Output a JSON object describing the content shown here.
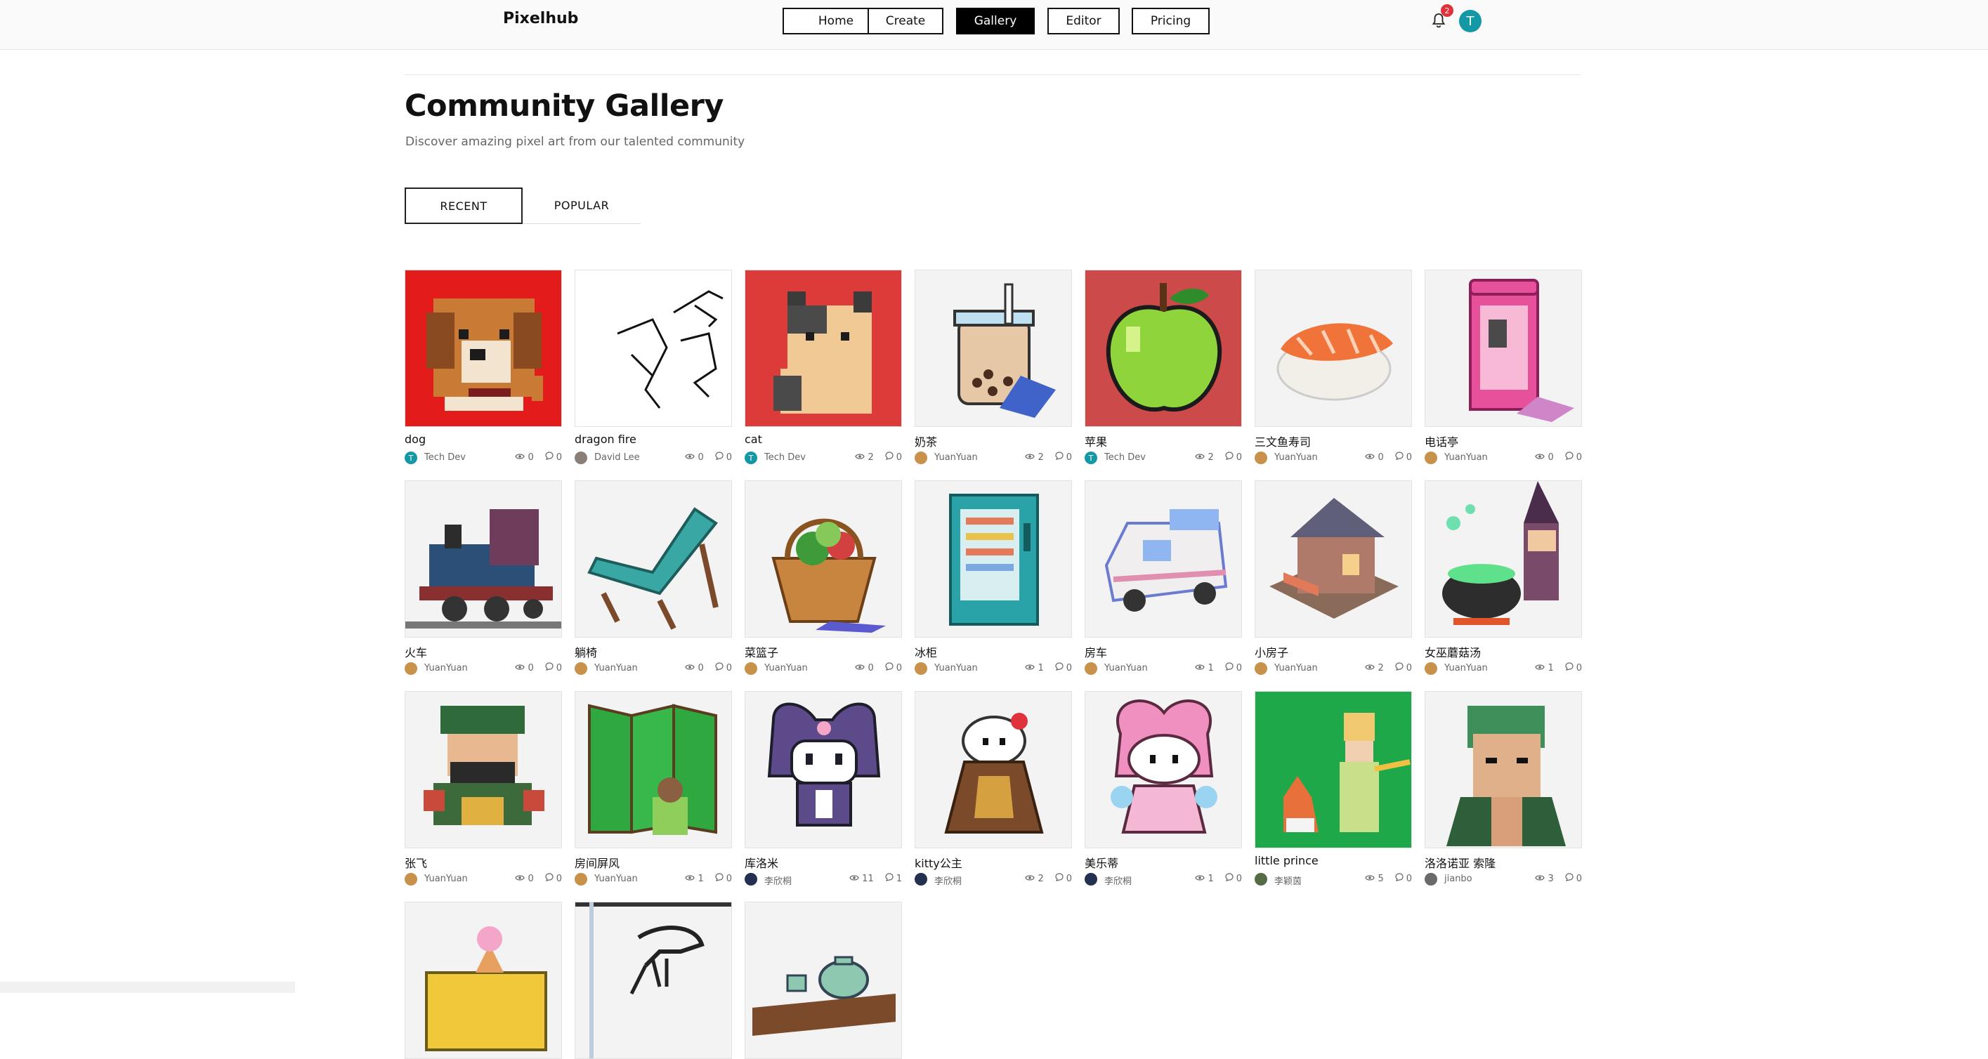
{
  "brand": "Pixelhub",
  "nav": [
    {
      "label": "Home",
      "active": false
    },
    {
      "label": "Create",
      "active": false
    },
    {
      "label": "Gallery",
      "active": true
    },
    {
      "label": "Editor",
      "active": false
    },
    {
      "label": "Pricing",
      "active": false
    }
  ],
  "notifications": {
    "count": "2"
  },
  "user": {
    "initial": "T"
  },
  "page": {
    "title": "Community Gallery",
    "subtitle": "Discover amazing pixel art from our talented community"
  },
  "tabs": [
    {
      "label": "RECENT",
      "active": true
    },
    {
      "label": "POPULAR",
      "active": false
    }
  ],
  "colors": {
    "accent": "#1598a6",
    "badge": "#e0323c"
  },
  "gallery": [
    {
      "title": "dog",
      "author": "Tech Dev",
      "avatar": "T",
      "avatar_color": "#1598a6",
      "views": "0",
      "comments": "0",
      "thumb_bg": "#e31b1b",
      "thumb": "dog-pixel-art"
    },
    {
      "title": "dragon fire",
      "author": "David Lee",
      "avatar": "",
      "avatar_color": "#8a7f76",
      "views": "0",
      "comments": "0",
      "thumb_bg": "#ffffff",
      "thumb": "line-sketch"
    },
    {
      "title": "cat",
      "author": "Tech Dev",
      "avatar": "T",
      "avatar_color": "#1598a6",
      "views": "2",
      "comments": "0",
      "thumb_bg": "#dd3a3a",
      "thumb": "cat-pixel-art"
    },
    {
      "title": "奶茶",
      "author": "YuanYuan",
      "avatar": "",
      "avatar_color": "#c8924a",
      "views": "2",
      "comments": "0",
      "thumb_bg": "#f3f3f3",
      "thumb": "bubble-tea"
    },
    {
      "title": "苹果",
      "author": "Tech Dev",
      "avatar": "T",
      "avatar_color": "#1598a6",
      "views": "2",
      "comments": "0",
      "thumb_bg": "#cd4a4a",
      "thumb": "green-apple"
    },
    {
      "title": "三文鱼寿司",
      "author": "YuanYuan",
      "avatar": "",
      "avatar_color": "#c8924a",
      "views": "0",
      "comments": "0",
      "thumb_bg": "#f3f3f3",
      "thumb": "salmon-sushi"
    },
    {
      "title": "电话亭",
      "author": "YuanYuan",
      "avatar": "",
      "avatar_color": "#c8924a",
      "views": "0",
      "comments": "0",
      "thumb_bg": "#f3f3f3",
      "thumb": "phone-booth"
    },
    {
      "title": "火车",
      "author": "YuanYuan",
      "avatar": "",
      "avatar_color": "#c8924a",
      "views": "0",
      "comments": "0",
      "thumb_bg": "#f3f3f3",
      "thumb": "train"
    },
    {
      "title": "躺椅",
      "author": "YuanYuan",
      "avatar": "",
      "avatar_color": "#c8924a",
      "views": "0",
      "comments": "0",
      "thumb_bg": "#f3f3f3",
      "thumb": "lounge-chair"
    },
    {
      "title": "菜篮子",
      "author": "YuanYuan",
      "avatar": "",
      "avatar_color": "#c8924a",
      "views": "0",
      "comments": "0",
      "thumb_bg": "#f3f3f3",
      "thumb": "vegetable-basket"
    },
    {
      "title": "冰柜",
      "author": "YuanYuan",
      "avatar": "",
      "avatar_color": "#c8924a",
      "views": "1",
      "comments": "0",
      "thumb_bg": "#f3f3f3",
      "thumb": "vending-fridge"
    },
    {
      "title": "房车",
      "author": "YuanYuan",
      "avatar": "",
      "avatar_color": "#c8924a",
      "views": "1",
      "comments": "0",
      "thumb_bg": "#f3f3f3",
      "thumb": "camper-van"
    },
    {
      "title": "小房子",
      "author": "YuanYuan",
      "avatar": "",
      "avatar_color": "#c8924a",
      "views": "2",
      "comments": "0",
      "thumb_bg": "#f3f3f3",
      "thumb": "small-house"
    },
    {
      "title": "女巫蘑菇汤",
      "author": "YuanYuan",
      "avatar": "",
      "avatar_color": "#c8924a",
      "views": "1",
      "comments": "0",
      "thumb_bg": "#f3f3f3",
      "thumb": "witch-cauldron"
    },
    {
      "title": "张飞",
      "author": "YuanYuan",
      "avatar": "",
      "avatar_color": "#c8924a",
      "views": "0",
      "comments": "0",
      "thumb_bg": "#f3f3f3",
      "thumb": "warrior"
    },
    {
      "title": "房间屏风",
      "author": "YuanYuan",
      "avatar": "",
      "avatar_color": "#c8924a",
      "views": "1",
      "comments": "0",
      "thumb_bg": "#f3f3f3",
      "thumb": "folding-screen"
    },
    {
      "title": "库洛米",
      "author": "李欣桐",
      "avatar": "",
      "avatar_color": "#243050",
      "views": "11",
      "comments": "1",
      "thumb_bg": "#f3f3f3",
      "thumb": "kuromi"
    },
    {
      "title": "kitty公主",
      "author": "李欣桐",
      "avatar": "",
      "avatar_color": "#243050",
      "views": "2",
      "comments": "0",
      "thumb_bg": "#f3f3f3",
      "thumb": "kitty-princess"
    },
    {
      "title": "美乐蒂",
      "author": "李欣桐",
      "avatar": "",
      "avatar_color": "#243050",
      "views": "1",
      "comments": "0",
      "thumb_bg": "#f3f3f3",
      "thumb": "melody"
    },
    {
      "title": "little prince",
      "author": "李颖茵",
      "avatar": "",
      "avatar_color": "#556b45",
      "views": "5",
      "comments": "0",
      "thumb_bg": "#1fa84a",
      "thumb": "little-prince"
    },
    {
      "title": "洛洛诺亚 索隆",
      "author": "jianbo",
      "avatar": "",
      "avatar_color": "#6a6a6a",
      "views": "3",
      "comments": "0",
      "thumb_bg": "#f3f3f3",
      "thumb": "zoro"
    },
    {
      "title": "",
      "author": "",
      "avatar": "",
      "avatar_color": "",
      "views": "",
      "comments": "",
      "thumb_bg": "#f3f3f3",
      "thumb": "ice-cream-truck"
    },
    {
      "title": "",
      "author": "",
      "avatar": "",
      "avatar_color": "",
      "views": "",
      "comments": "",
      "thumb_bg": "#f3f3f3",
      "thumb": "dino-skeleton"
    },
    {
      "title": "",
      "author": "",
      "avatar": "",
      "avatar_color": "",
      "views": "",
      "comments": "",
      "thumb_bg": "#f3f3f3",
      "thumb": "teapot"
    }
  ]
}
